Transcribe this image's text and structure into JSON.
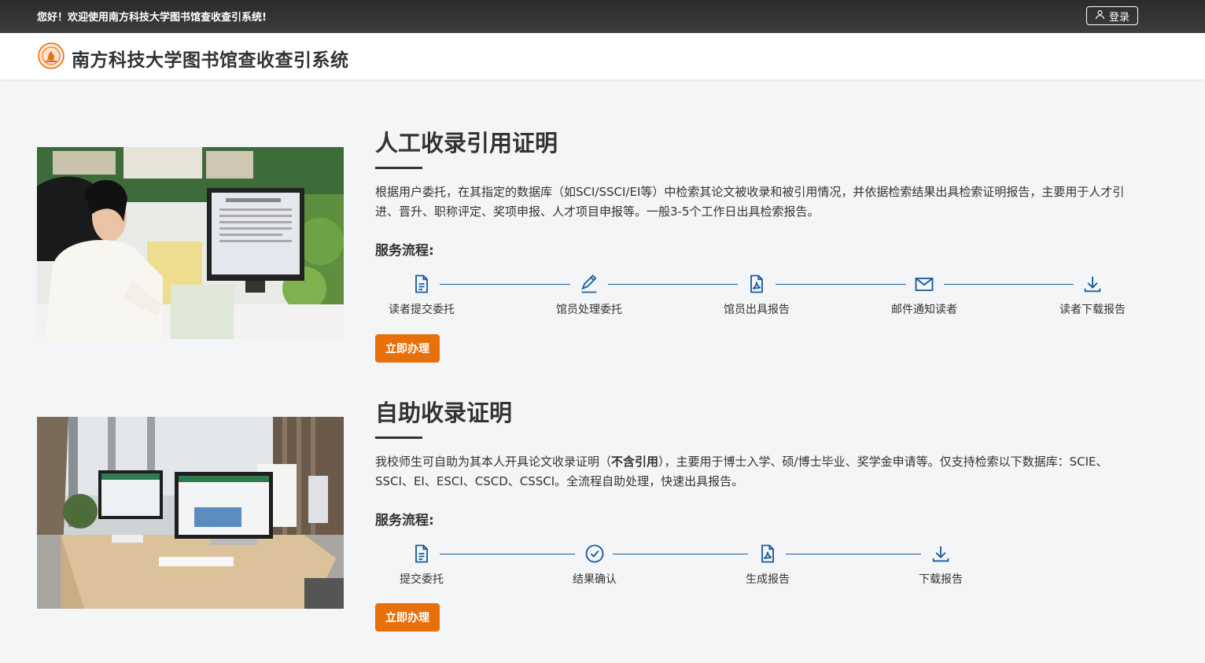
{
  "topbar": {
    "welcome": "您好！欢迎使用南方科技大学图书馆查收查引系统!",
    "login_label": "登录"
  },
  "header": {
    "title": "南方科技大学图书馆查收查引系统"
  },
  "services": [
    {
      "title": "人工收录引用证明",
      "description": "根据用户委托，在其指定的数据库（如SCI/SSCI/EI等）中检索其论文被收录和被引用情况，并依据检索结果出具检索证明报告，主要用于人才引进、晋升、职称评定、奖项申报、人才项目申报等。一般3-5个工作日出具检索报告。",
      "flow_label": "服务流程:",
      "steps": [
        {
          "label": "读者提交委托",
          "icon": "document-icon"
        },
        {
          "label": "馆员处理委托",
          "icon": "pencil-icon"
        },
        {
          "label": "馆员出具报告",
          "icon": "pdf-icon"
        },
        {
          "label": "邮件通知读者",
          "icon": "mail-icon"
        },
        {
          "label": "读者下载报告",
          "icon": "download-icon"
        }
      ],
      "button_label": "立即办理"
    },
    {
      "title": "自助收录证明",
      "description_pre": "我校师生可自助为其本人开具论文收录证明（",
      "description_bold": "不含引用",
      "description_post": "），主要用于博士入学、硕/博士毕业、奖学金申请等。仅支持检索以下数据库：SCIE、SSCI、EI、ESCI、CSCD、CSSCI。全流程自助处理，快速出具报告。",
      "flow_label": "服务流程:",
      "steps": [
        {
          "label": "提交委托",
          "icon": "document-icon"
        },
        {
          "label": "结果确认",
          "icon": "check-circle-icon"
        },
        {
          "label": "生成报告",
          "icon": "pdf-icon"
        },
        {
          "label": "下载报告",
          "icon": "download-icon"
        }
      ],
      "button_label": "立即办理"
    }
  ],
  "colors": {
    "accent_orange": "#e8700a",
    "icon_blue": "#1a5e9e",
    "topbar_dark": "#333333"
  }
}
